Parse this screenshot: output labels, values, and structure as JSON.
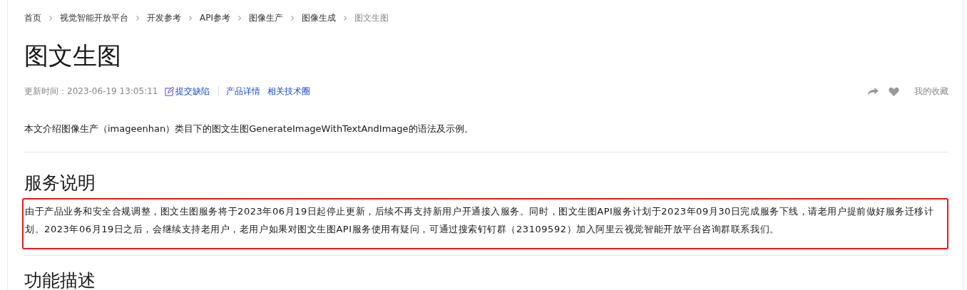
{
  "breadcrumb": [
    {
      "label": "首页",
      "current": false
    },
    {
      "label": "视觉智能开放平台",
      "current": false
    },
    {
      "label": "开发参考",
      "current": false
    },
    {
      "label": "API参考",
      "current": false
    },
    {
      "label": "图像生产",
      "current": false
    },
    {
      "label": "图像生成",
      "current": false
    },
    {
      "label": "图文生图",
      "current": true
    }
  ],
  "title": "图文生图",
  "meta": {
    "updated": "更新时间：2023-06-19 13:05:11",
    "links": [
      {
        "kind": "edit",
        "label": "提交缺陷"
      },
      {
        "kind": "divider",
        "label": "产品详情"
      },
      {
        "kind": "plain",
        "label": "相关技术圈"
      }
    ],
    "favorite": "我的收藏"
  },
  "intro": "本文介绍图像生产（imageenhan）类目下的图文生图GenerateImageWithTextAndImage的语法及示例。",
  "sections": [
    {
      "heading": "服务说明",
      "text": "由于产品业务和安全合规调整，图文生图服务将于2023年06月19日起停止更新，后续不再支持新用户开通接入服务。同时，图文生图API服务计划于2023年09月30日完成服务下线，请老用户提前做好服务迁移计划。2023年06月19日之后，会继续支持老用户，老用户如果对图文生图API服务使用有疑问，可通过搜索钉钉群（23109592）加入阿里云视觉智能开放平台咨询群联系我们。",
      "highlighted": true
    },
    {
      "heading": "功能描述"
    }
  ]
}
